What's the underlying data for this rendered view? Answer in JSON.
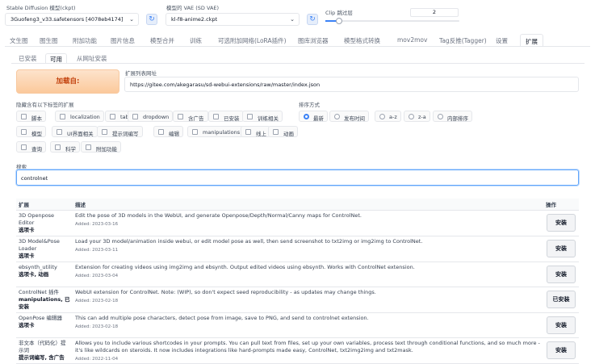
{
  "top": {
    "model_label": "Stable Diffusion 模型(ckpt)",
    "model_value": "3Guofeng3_v33.safetensors [4078eb4174]",
    "vae_label": "模型的 VAE (SD VAE)",
    "vae_value": "kl-f8-anime2.ckpt",
    "clip_label": "Clip 跳过层",
    "clip_value": "2",
    "clip_slider_fraction": 0.1
  },
  "main_tabs": [
    "文生图",
    "图生图",
    "附加功能",
    "图片信息",
    "模型合并",
    "训练",
    "可选附加网络(LoRA插件)",
    "图库浏览器",
    "模型格式转换",
    "mov2mov",
    "Tag反推(Tagger)",
    "设置",
    "扩展"
  ],
  "sub_tabs": [
    "已安装",
    "可用",
    "从网址安装"
  ],
  "load_button": "加载自:",
  "url_label": "扩展列表网址",
  "url_value": "https://gitee.com/akegarasu/sd-webui-extensions/raw/master/index.json",
  "hide_label": "隐藏含有以下标签的扩展",
  "hide_tags": [
    "脚本",
    "localization",
    "tab",
    "dropdown",
    "含广告",
    "已安装",
    "训练相关",
    "模型",
    "UI界面相关",
    "提示词编写",
    "编辑",
    "manipulations",
    "线上",
    "动画",
    "查询",
    "科学",
    "附加功能"
  ],
  "sort_label": "排序方式",
  "sort_options": [
    "最新",
    "发布时间",
    "a-z",
    "z-a",
    "内部排序"
  ],
  "search_label": "搜索",
  "search_value": "controlnet",
  "table": {
    "headers": [
      "扩展",
      "描述",
      "操作"
    ],
    "rows": [
      {
        "name": "3D Openpose Editor",
        "tags": "选项卡",
        "desc": "Edit the pose of 3D models in the WebUI, and generate Openpose/Depth/Normal/Canny maps for ControlNet.",
        "added": "Added: 2023-03-16",
        "action": "安装"
      },
      {
        "name": "3D Model&Pose Loader",
        "tags": "选项卡",
        "desc": "Load your 3D model/animation inside webui, or edit model pose as well, then send screenshot to txt2img or img2img to ControlNet.",
        "added": "Added: 2023-03-11",
        "action": "安装"
      },
      {
        "name": "ebsynth_utility",
        "tags": "选项卡, 动画",
        "desc": "Extension for creating videos using img2img and ebsynth. Output edited videos using ebsynth. Works with ControlNet extension.",
        "added": "Added: 2023-03-04",
        "action": "安装"
      },
      {
        "name": "ControlNet 插件",
        "tags": "manipulations, 已安装",
        "desc": "WebUI extension for ControlNet. Note: (WIP), so don't expect seed reproducibility - as updates may change things.",
        "added": "Added: 2023-02-18",
        "action": "已安装"
      },
      {
        "name": "OpenPose 编辑器",
        "tags": "选项卡",
        "desc": "This can add multiple pose characters, detect pose from image, save to PNG, and send to controlnet extension.",
        "added": "Added: 2023-02-18",
        "action": "安装"
      },
      {
        "name": "非文本（代码化）提示词",
        "tags": "提示词编写, 含广告",
        "desc": "Allows you to include various shortcodes in your prompts. You can pull text from files, set up your own variables, process text through conditional functions, and so much more - it's like wildcards on steroids. It now includes integrations like hard-prompts made easy, ControlNet, txt2img2img and txt2mask.",
        "added": "Added: 2022-11-04",
        "action": "安装"
      }
    ]
  }
}
